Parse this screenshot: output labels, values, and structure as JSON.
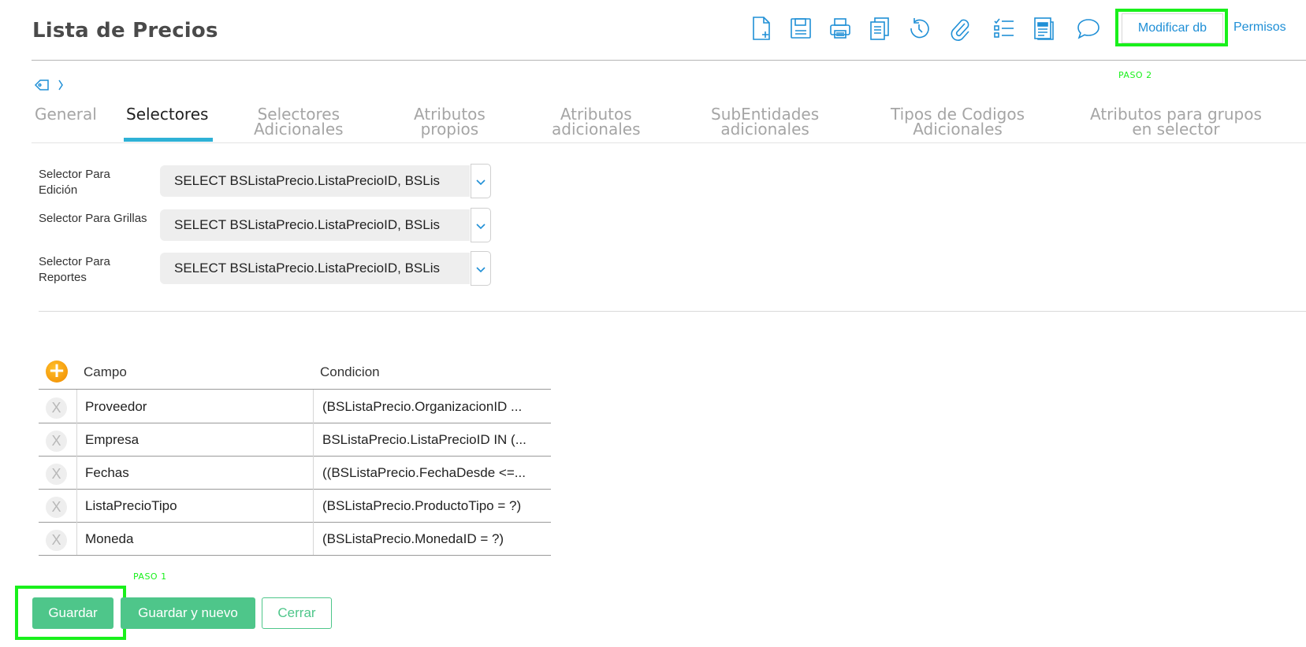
{
  "header": {
    "title": "Lista de Precios",
    "modificar_label": "Modificar db",
    "permisos_label": "Permisos",
    "paso2": "PASO 2"
  },
  "toolbar_icons": [
    "new-document-icon",
    "save-icon",
    "print-icon",
    "copy-icon",
    "history-icon",
    "attachment-icon",
    "checklist-icon",
    "report-icon",
    "comment-icon"
  ],
  "tabs": [
    {
      "label": "General",
      "active": false
    },
    {
      "label": "Selectores",
      "active": true
    },
    {
      "label": "Selectores\nAdicionales",
      "active": false
    },
    {
      "label": "Atributos\npropios",
      "active": false
    },
    {
      "label": "Atributos\nadicionales",
      "active": false
    },
    {
      "label": "SubEntidades\nadicionales",
      "active": false
    },
    {
      "label": "Tipos de Codigos\nAdicionales",
      "active": false
    },
    {
      "label": "Atributos para grupos\nen selector",
      "active": false
    }
  ],
  "selectors": [
    {
      "label": "Selector Para Edición",
      "value": "SELECT BSListaPrecio.ListaPrecioID, BSLis"
    },
    {
      "label": "Selector Para Grillas",
      "value": "SELECT BSListaPrecio.ListaPrecioID, BSLis"
    },
    {
      "label": "Selector Para Reportes",
      "value": "SELECT BSListaPrecio.ListaPrecioID, BSLis"
    }
  ],
  "grid": {
    "columns": [
      "Campo",
      "Condicion"
    ],
    "delete_glyph": "X",
    "rows": [
      {
        "campo": "Proveedor",
        "condicion": "(BSListaPrecio.OrganizacionID ..."
      },
      {
        "campo": "Empresa",
        "condicion": "BSListaPrecio.ListaPrecioID IN (..."
      },
      {
        "campo": "Fechas",
        "condicion": "((BSListaPrecio.FechaDesde <=..."
      },
      {
        "campo": "ListaPrecioTipo",
        "condicion": "(BSListaPrecio.ProductoTipo = ?)"
      },
      {
        "campo": "Moneda",
        "condicion": "(BSListaPrecio.MonedaID = ?)"
      }
    ]
  },
  "footer": {
    "paso1": "PASO 1",
    "guardar": "Guardar",
    "guardar_nuevo": "Guardar y nuevo",
    "cerrar": "Cerrar"
  },
  "colors": {
    "accent_blue": "#1f8fd6",
    "tab_underline": "#2eb1d6",
    "primary_green": "#4ec68a",
    "highlight_green": "#19f01b",
    "add_orange": "#f5a000"
  }
}
